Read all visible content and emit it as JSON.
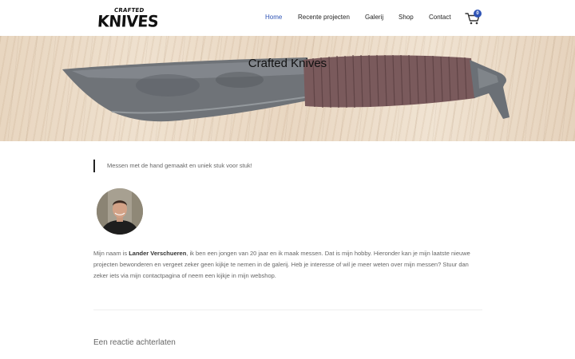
{
  "header": {
    "logo_small": "CRAFTED",
    "logo_big": "KNIVES",
    "nav": [
      {
        "label": "Home"
      },
      {
        "label": "Recente projecten"
      },
      {
        "label": "Galerij"
      },
      {
        "label": "Shop"
      },
      {
        "label": "Contact"
      }
    ],
    "cart_icon": "shopping-cart-icon",
    "cart_count": "0",
    "accent_color": "#2f54b5"
  },
  "hero": {
    "title": "Crafted Knives"
  },
  "content": {
    "quote": "Messen met de hand gemaakt en uniek stuk voor stuk!",
    "intro_prefix": "Mijn naam is ",
    "intro_name": "Lander Verschueren",
    "intro_rest": ", ik ben een jongen van 20 jaar en ik maak messen. Dat is mijn hobby. Hieronder kan je mijn laatste nieuwe projecten bewonderen en vergeet zeker geen kijkje te nemen in de galerij. Heb je interesse of wil je meer weten over mijn messen? Stuur dan zeker iets via mijn contactpagina of neem een kijkje in mijn webshop.",
    "reply_title": "Een reactie achterlaten"
  }
}
